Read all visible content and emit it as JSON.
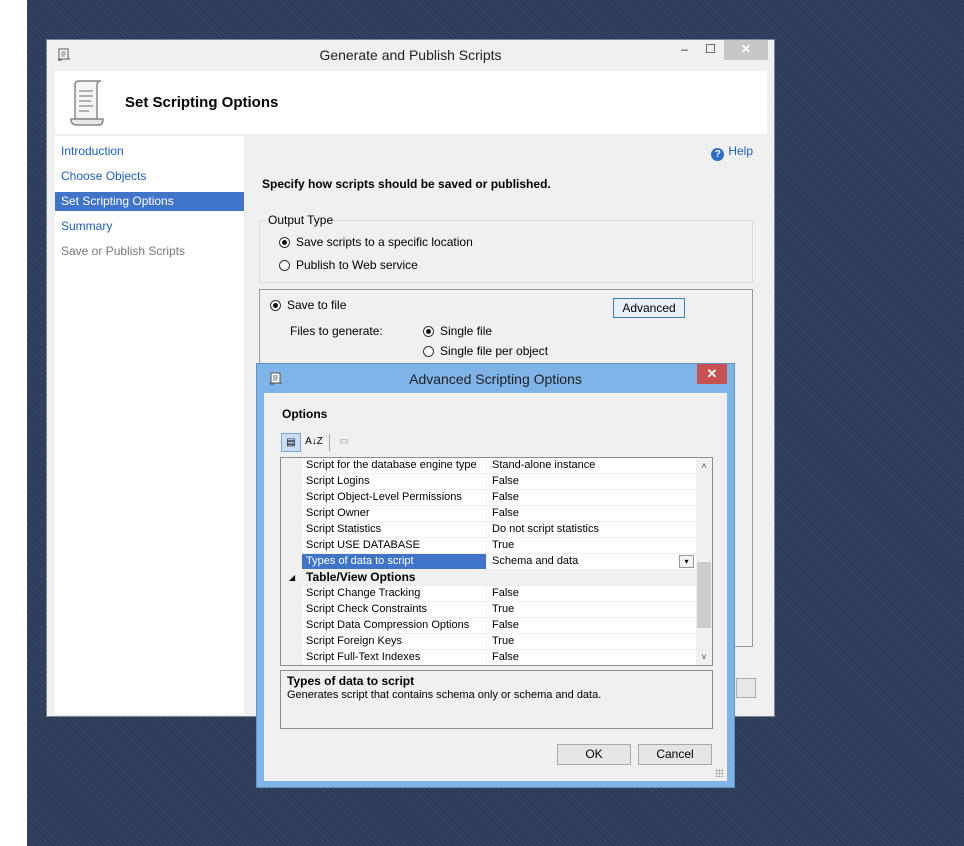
{
  "main_window": {
    "title": "Generate and Publish Scripts",
    "controls": {
      "minimize": "–",
      "maximize": "☐",
      "close": "✕"
    },
    "header_title": "Set Scripting Options",
    "nav": [
      {
        "label": "Introduction"
      },
      {
        "label": "Choose Objects"
      },
      {
        "label": "Set Scripting Options"
      },
      {
        "label": "Summary"
      },
      {
        "label": "Save or Publish Scripts"
      }
    ],
    "help_label": "Help",
    "instruction": "Specify how scripts should be saved or published.",
    "output_type": {
      "label": "Output Type",
      "option_save": "Save scripts to a specific location",
      "option_publish": "Publish to Web service",
      "selected": "save"
    },
    "save_to_file": {
      "label": "Save to file",
      "advanced_button": "Advanced",
      "files_label": "Files to generate:",
      "single_file": "Single file",
      "single_per_object": "Single file per object",
      "selected": "single"
    }
  },
  "advanced_dialog": {
    "title": "Advanced Scripting Options",
    "close": "✕",
    "options_title": "Options",
    "toolbar": {
      "categorized": "▤",
      "alphabetical": "A↓Z",
      "property_pages": "▭"
    },
    "rows": [
      {
        "name": "Script for the database engine type",
        "value": "Stand-alone instance"
      },
      {
        "name": "Script Logins",
        "value": "False"
      },
      {
        "name": "Script Object-Level Permissions",
        "value": "False"
      },
      {
        "name": "Script Owner",
        "value": "False"
      },
      {
        "name": "Script Statistics",
        "value": "Do not script statistics"
      },
      {
        "name": "Script USE DATABASE",
        "value": "True"
      },
      {
        "name": "Types of data to script",
        "value": "Schema and data"
      },
      {
        "name": "Table/View Options",
        "value": ""
      },
      {
        "name": "Script Change Tracking",
        "value": "False"
      },
      {
        "name": "Script Check Constraints",
        "value": "True"
      },
      {
        "name": "Script Data Compression Options",
        "value": "False"
      },
      {
        "name": "Script Foreign Keys",
        "value": "True"
      },
      {
        "name": "Script Full-Text Indexes",
        "value": "False"
      }
    ],
    "category_expander": "◢",
    "dropdown_glyph": "▾",
    "scroll_up": "˄",
    "scroll_down": "˅",
    "description": {
      "title": "Types of data to script",
      "text": "Generates script that contains schema only or schema and data."
    },
    "ok_label": "OK",
    "cancel_label": "Cancel"
  }
}
